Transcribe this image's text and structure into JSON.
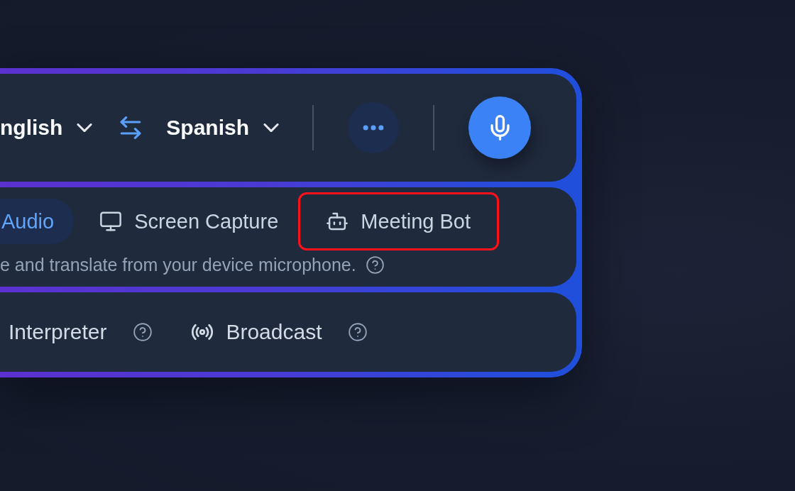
{
  "language_bar": {
    "source_language": "nglish",
    "target_language": "Spanish"
  },
  "input_modes": [
    {
      "label": "Audio",
      "selected": true,
      "highlighted": false
    },
    {
      "label": "Screen Capture",
      "selected": false,
      "highlighted": false
    },
    {
      "label": "Meeting Bot",
      "selected": false,
      "highlighted": true
    }
  ],
  "mode_description": "e and translate from your device microphone.",
  "output_modes": [
    {
      "label": "Interpreter"
    },
    {
      "label": "Broadcast"
    }
  ]
}
